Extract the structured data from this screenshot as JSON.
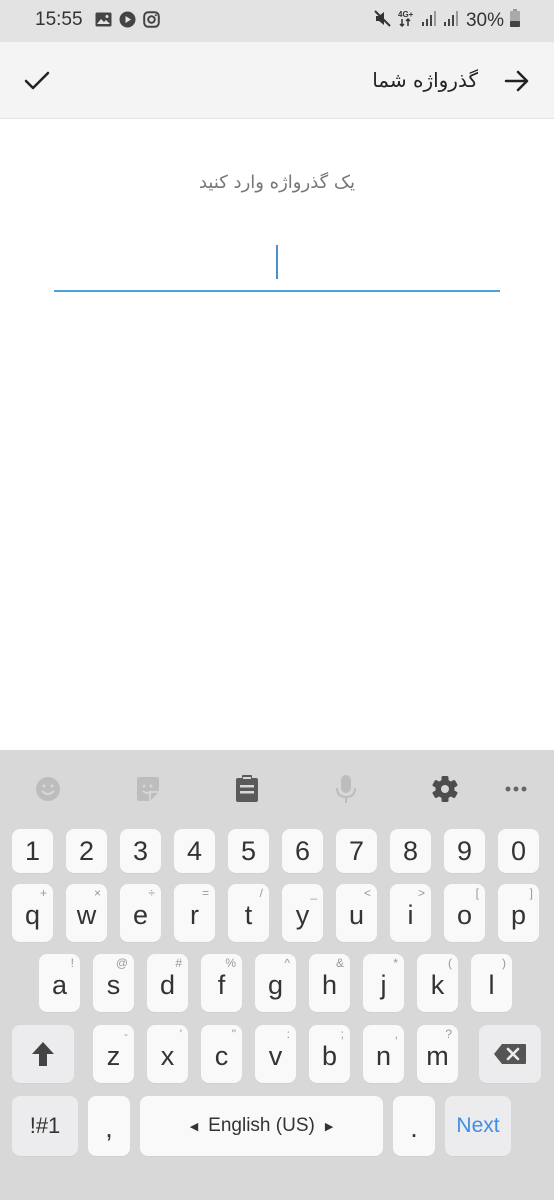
{
  "status_bar": {
    "time": "15:55",
    "left_icons": [
      "gallery-icon",
      "play-icon",
      "instagram-icon"
    ],
    "right_icons": [
      "mute-icon",
      "network-4g-plus-icon",
      "signal-icon",
      "signal-icon"
    ],
    "network_label": "4G+",
    "battery_percent": "30%",
    "battery_level": 0.3
  },
  "app_bar": {
    "title": "گذرواژه شما",
    "confirm_icon": "check-icon",
    "back_icon": "arrow-right-icon"
  },
  "content": {
    "hint": "یک گذرواژه وارد کنید",
    "password_value": "",
    "accent_color": "#4ea2dc"
  },
  "keyboard": {
    "toolbar": [
      "emoji-icon",
      "sticker-icon",
      "clipboard-icon",
      "mic-icon",
      "settings-icon",
      "more-icon"
    ],
    "number_row": [
      "1",
      "2",
      "3",
      "4",
      "5",
      "6",
      "7",
      "8",
      "9",
      "0"
    ],
    "row1": [
      {
        "key": "q",
        "sub": "+"
      },
      {
        "key": "w",
        "sub": "×"
      },
      {
        "key": "e",
        "sub": "÷"
      },
      {
        "key": "r",
        "sub": "="
      },
      {
        "key": "t",
        "sub": "/"
      },
      {
        "key": "y",
        "sub": "_"
      },
      {
        "key": "u",
        "sub": "<"
      },
      {
        "key": "i",
        "sub": ">"
      },
      {
        "key": "o",
        "sub": "["
      },
      {
        "key": "p",
        "sub": "]"
      }
    ],
    "row2": [
      {
        "key": "a",
        "sub": "!"
      },
      {
        "key": "s",
        "sub": "@"
      },
      {
        "key": "d",
        "sub": "#"
      },
      {
        "key": "f",
        "sub": "%"
      },
      {
        "key": "g",
        "sub": "^"
      },
      {
        "key": "h",
        "sub": "&"
      },
      {
        "key": "j",
        "sub": "*"
      },
      {
        "key": "k",
        "sub": "("
      },
      {
        "key": "l",
        "sub": ")"
      }
    ],
    "row3": [
      {
        "key": "z",
        "sub": "-"
      },
      {
        "key": "x",
        "sub": "'"
      },
      {
        "key": "c",
        "sub": "\""
      },
      {
        "key": "v",
        "sub": ":"
      },
      {
        "key": "b",
        "sub": ";"
      },
      {
        "key": "n",
        "sub": ","
      },
      {
        "key": "m",
        "sub": "?"
      }
    ],
    "symbols_label": "!#1",
    "comma_label": ",",
    "space_label": "English (US)",
    "period_label": ".",
    "next_label": "Next",
    "next_color": "#3d8ee6"
  }
}
